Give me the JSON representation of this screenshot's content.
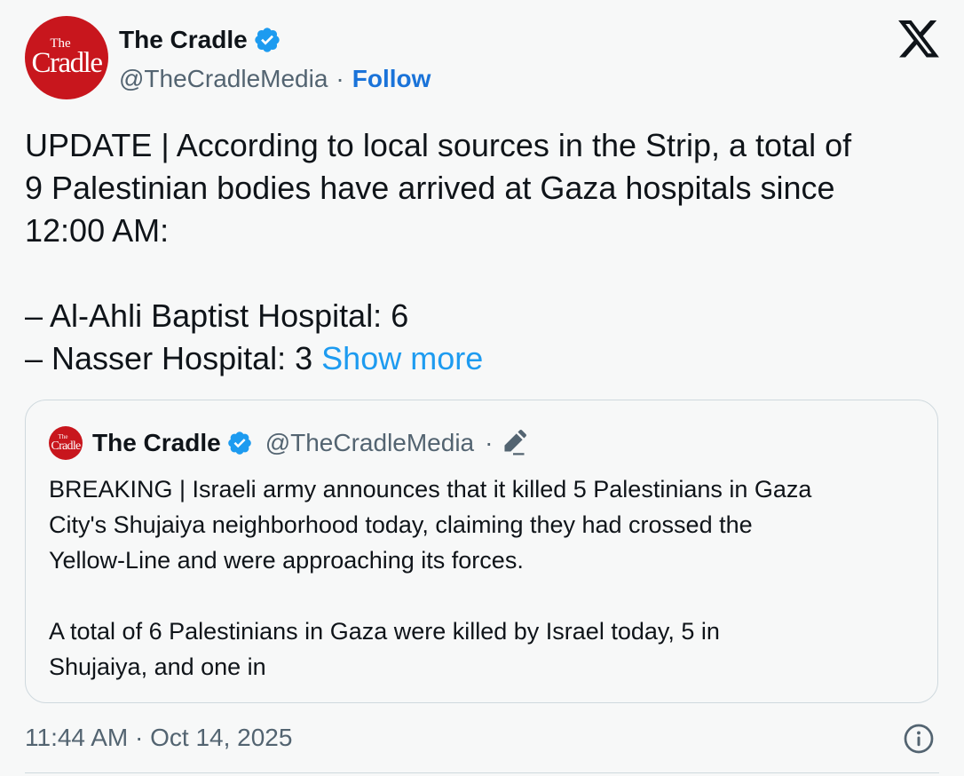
{
  "author": {
    "name": "The Cradle",
    "handle": "@TheCradleMedia",
    "separator": "·",
    "follow_label": "Follow",
    "avatar_small_text": "The",
    "avatar_big_text": "Cradle",
    "verified_icon": "verified-badge-icon",
    "avatar_color": "#c8161d"
  },
  "platform_icon": "x-logo-icon",
  "tweet": {
    "lines": [
      "UPDATE | According to local sources in the Strip, a total of",
      "9 Palestinian bodies have arrived at Gaza hospitals since",
      "12:00 AM:",
      "",
      "– Al-Ahli Baptist Hospital: 6",
      "– Nasser Hospital: 3 "
    ],
    "show_more_label": "Show more"
  },
  "quote": {
    "name": "The Cradle",
    "handle": "@TheCradleMedia",
    "separator": "·",
    "avatar_small_text": "The",
    "avatar_big_text": "Cradle",
    "edit_icon": "edit-pencil-icon",
    "lines": [
      "BREAKING | Israeli army announces that it killed 5 Palestinians in Gaza",
      "City's Shujaiya neighborhood today, claiming they had crossed the",
      "Yellow-Line and were approaching its forces.",
      "",
      "A total of 6 Palestinians in Gaza were killed by Israel today, 5 in",
      "Shujaiya, and one in"
    ]
  },
  "timestamp": "11:44 AM · Oct 14, 2025",
  "info_icon": "info-icon",
  "colors": {
    "link": "#1d9bf0",
    "follow": "#1a73d9",
    "secondary_text": "#536471",
    "verified": "#1d9bf0"
  }
}
